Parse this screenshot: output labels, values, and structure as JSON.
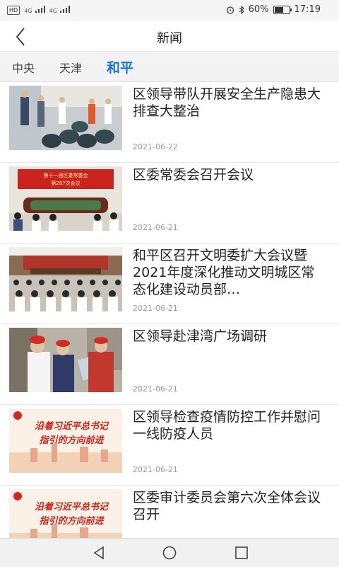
{
  "status_bar": {
    "hd": "HD",
    "signal_1": "4G",
    "signal_2": "4G",
    "battery_text": "60%",
    "battery_level": 0.6,
    "time": "17:19",
    "icons": [
      "alarm-icon",
      "bluetooth-icon",
      "battery-icon"
    ]
  },
  "header": {
    "title": "新闻",
    "back_icon": "back-chevron-icon"
  },
  "tabs": [
    {
      "label": "中央",
      "active": false
    },
    {
      "label": "天津",
      "active": false
    },
    {
      "label": "和平",
      "active": true
    }
  ],
  "accent_color": "#1a73d9",
  "news": [
    {
      "title": "区领导带队开展安全生产隐患大排查大整治",
      "date": "2021-06-22"
    },
    {
      "title": "区委常委会召开会议",
      "date": "2021-06-21",
      "thumb_banner_1": "第十一届区委常委会",
      "thumb_banner_2": "第287次会议"
    },
    {
      "title": "和平区召开文明委扩大会议暨2021年度深化推动文明城区常态化建设动员部…",
      "date": "2021-06-21"
    },
    {
      "title": "区领导赴津湾广场调研",
      "date": "2021-06-21"
    },
    {
      "title": "区领导检查疫情防控工作并慰问一线防疫人员",
      "date": "2021-06-21",
      "thumb_line_1": "沿着习近平总书记",
      "thumb_line_2": "指引的方向前进"
    },
    {
      "title": "区委审计委员会第六次全体会议召开",
      "date": "",
      "thumb_line_1": "沿着习近平总书记",
      "thumb_line_2": "指引的方向前进"
    }
  ],
  "bottom_nav": {
    "icons": [
      "back-triangle-icon",
      "home-circle-icon",
      "recents-square-icon"
    ]
  }
}
